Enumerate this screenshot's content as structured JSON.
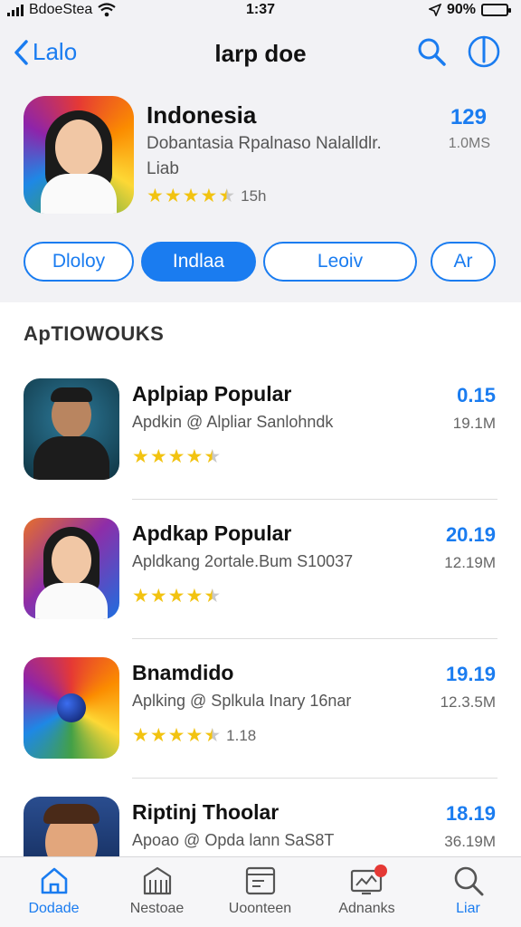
{
  "status_bar": {
    "carrier": "BdoeStea",
    "time": "1:37",
    "battery": "90%",
    "battery_level": 0.9
  },
  "nav": {
    "back_label": "Lalo",
    "title": "larp doe"
  },
  "featured": {
    "title": "Indonesia",
    "subtitle": "Dobantasia Rpalnaso Nalalldlr.",
    "subtitle2": "Liab",
    "rating": 4.5,
    "rating_count": "15h",
    "price": "129",
    "size": "1.0MS"
  },
  "chips": [
    {
      "label": "Dloloy",
      "active": false
    },
    {
      "label": "Indlaa",
      "active": true
    },
    {
      "label": "Leoiv",
      "active": false
    },
    {
      "label": "Ar",
      "active": false
    }
  ],
  "section_title": "ApTIOWOUKS",
  "apps": [
    {
      "name": "Aplpiap Popular",
      "desc": "Apdkin @ Alpliar Sanlohndk",
      "rating": 4.5,
      "rating_count": "",
      "price": "0.15",
      "size": "19.1M"
    },
    {
      "name": "Apdkap Popular",
      "desc": "Apldkang 2ortale.Bum S10037",
      "rating": 4.5,
      "rating_count": "",
      "price": "20.19",
      "size": "12.19M"
    },
    {
      "name": "Bnamdido",
      "desc": "Aplking @ Splkula Inary 16nar",
      "rating": 4.5,
      "rating_count": "1.18",
      "price": "19.19",
      "size": "12.3.5M"
    },
    {
      "name": "Riptinj Thoolar",
      "desc": "Apoao @ Opda lann SaS8T",
      "rating": 4.5,
      "rating_count": "",
      "price": "18.19",
      "size": "36.19M"
    }
  ],
  "tabs": [
    {
      "label": "Dodade",
      "icon": "home-icon",
      "active": true
    },
    {
      "label": "Nestoae",
      "icon": "store-icon",
      "active": false
    },
    {
      "label": "Uoonteen",
      "icon": "browser-icon",
      "active": false
    },
    {
      "label": "Adnanks",
      "icon": "updates-icon",
      "active": false
    },
    {
      "label": "Liar",
      "icon": "search-icon",
      "active": true
    }
  ],
  "colors": {
    "accent": "#1a7cf0",
    "star": "#f2c311",
    "header_bg": "#f2f2f5",
    "badge": "#e53935"
  }
}
